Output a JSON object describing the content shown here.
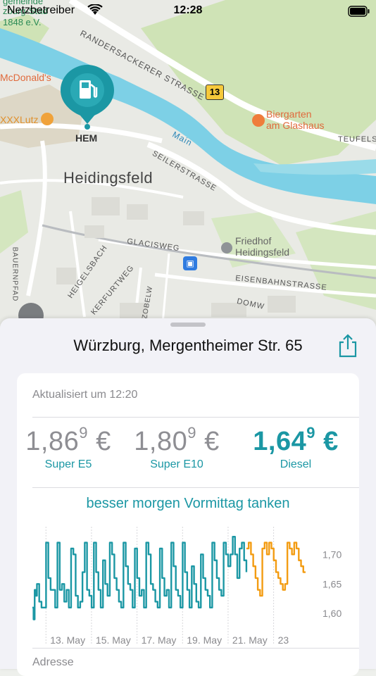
{
  "status_bar": {
    "carrier": "Netzbetreiber",
    "time": "12:28"
  },
  "map": {
    "labels": {
      "gemeinde": "gemeinde",
      "partial": "zburg-Stad",
      "ev": "1848 e.V.",
      "mcdonalds": "McDonald's",
      "xxxlutz": "XXXLutz",
      "randersackerer": "RANDERSACKERER STRASSE",
      "route13": "13",
      "biergarten": "Biergarten\nam Glashaus",
      "teufels": "TEUFELS",
      "main": "Main",
      "seiler": "SEILERSTRASSE",
      "heidingsfeld": "Heidingsfeld",
      "friedhof": "Friedhof\nHeidingsfeld",
      "glacis": "GLACISWEG",
      "eisenbahn": "EISENBAHNSTRASSE",
      "domw": "DOMW",
      "bauernpfad": "BAUERNPFAD",
      "heigelsbach": "HEIGELSBACH",
      "kerfurt": "KERFURTWEG",
      "zobelw": "ZOBELW",
      "hem": "HEM"
    },
    "icons": [
      "fuel-pin-icon",
      "train-station-icon",
      "biergarten-icon",
      "shop-icon",
      "cemetery-icon"
    ]
  },
  "sheet": {
    "title": "Würzburg, Mergentheimer Str. 65",
    "updated": "Aktualisiert um 12:20",
    "prices": [
      {
        "main": "1,86",
        "sup": "9",
        "currency": "€",
        "name": "Super E5",
        "best": false
      },
      {
        "main": "1,80",
        "sup": "9",
        "currency": "€",
        "name": "Super E10",
        "best": false
      },
      {
        "main": "1,64",
        "sup": "9",
        "currency": "€",
        "name": "Diesel",
        "best": true
      }
    ],
    "recommendation": "besser morgen Vormittag tanken",
    "address_label": "Adresse"
  },
  "colors": {
    "accent": "#1b97a4",
    "forecast": "#f39c12"
  },
  "chart_data": {
    "type": "line",
    "title": "",
    "xlabel": "",
    "ylabel": "",
    "x_ticks": [
      "13. May",
      "15. May",
      "17. May",
      "19. May",
      "21. May",
      "23"
    ],
    "y_ticks": [
      "1,70",
      "1,65",
      "1,60"
    ],
    "ylim": [
      1.58,
      1.735
    ],
    "grid": true,
    "series": [
      {
        "kind": "history",
        "x": [
          11.6,
          11.65,
          11.7,
          11.75,
          11.8,
          11.9,
          12.0,
          12.1,
          12.2,
          12.3,
          12.4,
          12.5,
          12.6,
          12.7,
          12.8,
          12.9,
          13.0,
          13.1,
          13.2,
          13.3,
          13.4,
          13.5,
          13.6,
          13.7,
          13.8,
          13.9,
          14.0,
          14.1,
          14.2,
          14.3,
          14.4,
          14.5,
          14.6,
          14.7,
          14.8,
          14.9,
          15.0,
          15.1,
          15.2,
          15.3,
          15.4,
          15.5,
          15.6,
          15.7,
          15.8,
          15.9,
          16.0,
          16.1,
          16.2,
          16.3,
          16.4,
          16.5,
          16.6,
          16.7,
          16.8,
          16.9,
          17.0,
          17.1,
          17.2,
          17.3,
          17.4,
          17.5,
          17.6,
          17.7,
          17.8,
          17.9,
          18.0,
          18.1,
          18.2,
          18.3,
          18.4,
          18.5,
          18.6,
          18.7,
          18.8,
          18.9,
          19.0,
          19.1,
          19.2,
          19.3,
          19.4,
          19.5,
          19.6,
          19.7,
          19.8,
          19.9,
          20.0,
          20.1,
          20.2,
          20.3,
          20.4,
          20.5,
          20.6,
          20.7,
          20.8,
          20.9,
          21.0
        ],
        "y": [
          1.61,
          1.59,
          1.64,
          1.63,
          1.65,
          1.62,
          1.61,
          1.61,
          1.72,
          1.66,
          1.64,
          1.64,
          1.61,
          1.72,
          1.64,
          1.65,
          1.62,
          1.64,
          1.61,
          1.71,
          1.7,
          1.63,
          1.61,
          1.62,
          1.67,
          1.72,
          1.64,
          1.63,
          1.61,
          1.72,
          1.67,
          1.64,
          1.61,
          1.69,
          1.65,
          1.63,
          1.72,
          1.7,
          1.66,
          1.64,
          1.62,
          1.61,
          1.72,
          1.68,
          1.65,
          1.64,
          1.61,
          1.71,
          1.66,
          1.63,
          1.64,
          1.61,
          1.72,
          1.7,
          1.65,
          1.64,
          1.62,
          1.61,
          1.71,
          1.66,
          1.63,
          1.64,
          1.61,
          1.72,
          1.68,
          1.64,
          1.63,
          1.61,
          1.72,
          1.67,
          1.64,
          1.61,
          1.68,
          1.65,
          1.62,
          1.61,
          1.7,
          1.66,
          1.64,
          1.63,
          1.61,
          1.72,
          1.69,
          1.66,
          1.64,
          1.63,
          1.72,
          1.7,
          1.68,
          1.7,
          1.73,
          1.7,
          1.66,
          1.71,
          1.72,
          1.69,
          1.67
        ]
      },
      {
        "kind": "forecast",
        "x": [
          21.0,
          21.1,
          21.2,
          21.3,
          21.4,
          21.5,
          21.6,
          21.7,
          21.8,
          21.9,
          22.0,
          22.1,
          22.2,
          22.3,
          22.4,
          22.5,
          22.6,
          22.7,
          22.8,
          22.9,
          23.0,
          23.1,
          23.2,
          23.3,
          23.4,
          23.5,
          23.6
        ],
        "y": [
          1.71,
          1.72,
          1.7,
          1.68,
          1.66,
          1.64,
          1.63,
          1.71,
          1.72,
          1.7,
          1.72,
          1.71,
          1.69,
          1.67,
          1.66,
          1.65,
          1.64,
          1.65,
          1.72,
          1.71,
          1.7,
          1.72,
          1.71,
          1.69,
          1.68,
          1.67,
          1.67
        ]
      }
    ]
  }
}
